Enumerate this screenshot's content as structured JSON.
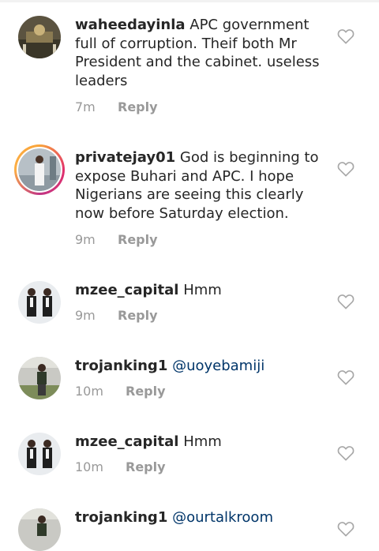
{
  "comments": [
    {
      "username": "waheedayinla",
      "text": "APC government full of corruption. Theif both Mr President and the cabinet. useless leaders",
      "mention": "",
      "time": "7m",
      "reply_label": "Reply"
    },
    {
      "username": "privatejay01",
      "text": "God is beginning to expose Buhari and APC.  I hope Nigerians are seeing this clearly now before Saturday election.",
      "mention": "",
      "time": "9m",
      "reply_label": "Reply"
    },
    {
      "username": "mzee_capital",
      "text": "Hmm",
      "mention": "",
      "time": "9m",
      "reply_label": "Reply"
    },
    {
      "username": "trojanking1",
      "text": "",
      "mention": "@uoyebamiji",
      "time": "10m",
      "reply_label": "Reply"
    },
    {
      "username": "mzee_capital",
      "text": "Hmm",
      "mention": "",
      "time": "10m",
      "reply_label": "Reply"
    },
    {
      "username": "trojanking1",
      "text": "",
      "mention": "@ourtalkroom",
      "time": "",
      "reply_label": ""
    }
  ],
  "icons": {
    "like": "heart-outline-icon",
    "avatar": "user-avatar"
  },
  "colors": {
    "username": "#262626",
    "mention": "#003569",
    "meta": "#999999",
    "heart": "#a8a8a8"
  }
}
